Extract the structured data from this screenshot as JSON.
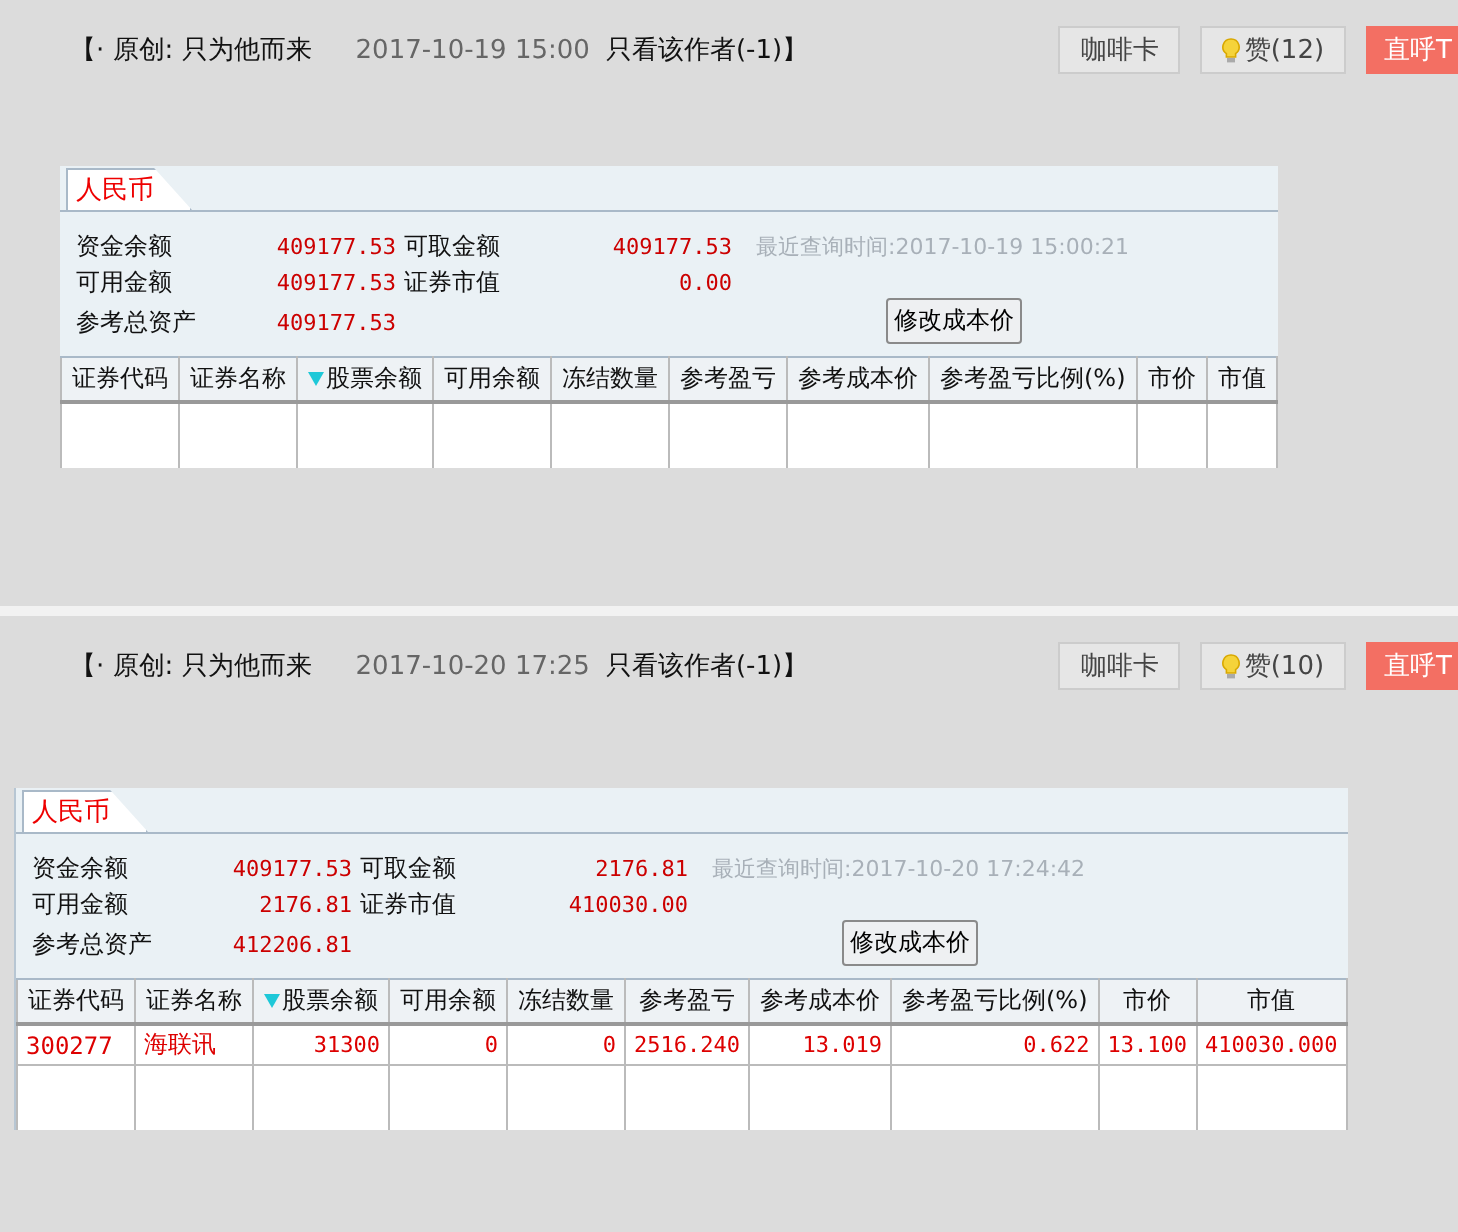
{
  "posts": [
    {
      "title": "【· 原创: 只为他而来",
      "time": "2017-10-19 15:00",
      "only_author": "只看该作者(-1)】",
      "buttons": [
        {
          "kind": "plain",
          "label": "咖啡卡"
        },
        {
          "kind": "like",
          "label": "赞(12)"
        },
        {
          "kind": "accent",
          "label": "直呼T"
        }
      ],
      "account": {
        "tab": "人民币",
        "fields": [
          {
            "label": "资金余额",
            "value": "409177.53"
          },
          {
            "label": "可取金额",
            "value": "409177.53"
          },
          {
            "label": "可用金额",
            "value": "409177.53"
          },
          {
            "label": "证券市值",
            "value": "0.00"
          },
          {
            "label": "参考总资产",
            "value": "409177.53"
          }
        ],
        "query_time": "最近查询时间:2017-10-19 15:00:21",
        "action": "修改成本价",
        "table": {
          "columns": [
            {
              "label": "证券代码",
              "sorted": false
            },
            {
              "label": "证券名称",
              "sorted": false
            },
            {
              "label": "股票余额",
              "sorted": true
            },
            {
              "label": "可用余额",
              "sorted": false
            },
            {
              "label": "冻结数量",
              "sorted": false
            },
            {
              "label": "参考盈亏",
              "sorted": false
            },
            {
              "label": "参考成本价",
              "sorted": false
            },
            {
              "label": "参考盈亏比例(%)",
              "sorted": false
            },
            {
              "label": "市价",
              "sorted": false
            },
            {
              "label": "市值",
              "sorted": false
            }
          ]
        }
      }
    },
    {
      "title": "【· 原创: 只为他而来",
      "time": "2017-10-20 17:25",
      "only_author": "只看该作者(-1)】",
      "buttons": [
        {
          "kind": "plain",
          "label": "咖啡卡"
        },
        {
          "kind": "like",
          "label": "赞(10)"
        },
        {
          "kind": "accent",
          "label": "直呼T"
        }
      ],
      "account": {
        "tab": "人民币",
        "fields": [
          {
            "label": "资金余额",
            "value": "409177.53"
          },
          {
            "label": "可取金额",
            "value": "2176.81"
          },
          {
            "label": "可用金额",
            "value": "2176.81"
          },
          {
            "label": "证券市值",
            "value": "410030.00"
          },
          {
            "label": "参考总资产",
            "value": "412206.81"
          }
        ],
        "query_time": "最近查询时间:2017-10-20 17:24:42",
        "action": "修改成本价",
        "table": {
          "columns": [
            {
              "label": "证券代码",
              "sorted": false
            },
            {
              "label": "证券名称",
              "sorted": false
            },
            {
              "label": "股票余额",
              "sorted": true
            },
            {
              "label": "可用余额",
              "sorted": false
            },
            {
              "label": "冻结数量",
              "sorted": false
            },
            {
              "label": "参考盈亏",
              "sorted": false
            },
            {
              "label": "参考成本价",
              "sorted": false
            },
            {
              "label": "参考盈亏比例(%)",
              "sorted": false
            },
            {
              "label": "市价",
              "sorted": false
            },
            {
              "label": "市值",
              "sorted": false
            }
          ],
          "rows": [
            [
              "300277",
              "海联讯",
              "31300",
              "0",
              "0",
              "2516.240",
              "13.019",
              "0.622",
              "13.100",
              "410030.000"
            ]
          ]
        }
      }
    }
  ]
}
